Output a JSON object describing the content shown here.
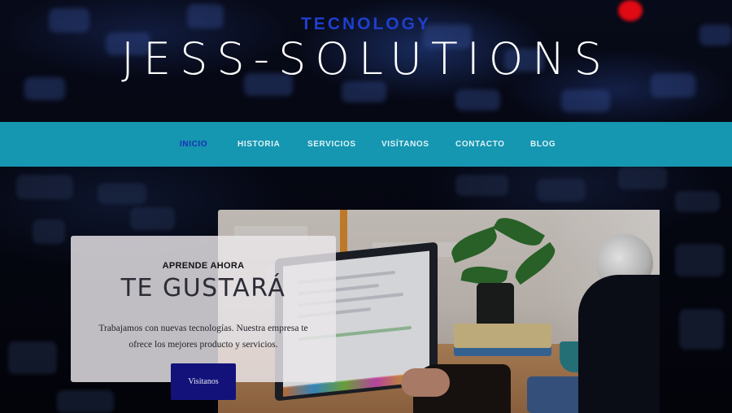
{
  "header": {
    "tagline": "TECNOLOGY",
    "brand": "JESS-SOLUTIONS"
  },
  "nav": {
    "items": [
      {
        "label": "INICIO",
        "active": true
      },
      {
        "label": "HISTORIA",
        "active": false
      },
      {
        "label": "SERVICIOS",
        "active": false
      },
      {
        "label": "VISÍTANOS",
        "active": false
      },
      {
        "label": "CONTACTO",
        "active": false
      },
      {
        "label": "BLOG",
        "active": false
      }
    ]
  },
  "hero": {
    "kicker": "APRENDE AHORA",
    "title": "TE GUSTARÁ",
    "text": "Trabajamos con nuevas tecnologías. Nuestra empresa te ofrece los mejores producto y servicios.",
    "button": "Visitanos"
  },
  "colors": {
    "nav_background": "#1596b1",
    "nav_active": "#1d2fb3",
    "tagline": "#1f3fcf",
    "button": "#12127a"
  },
  "icons": {
    "hero_photo": "laptop-workspace-photo",
    "background": "keyboard-photo"
  }
}
